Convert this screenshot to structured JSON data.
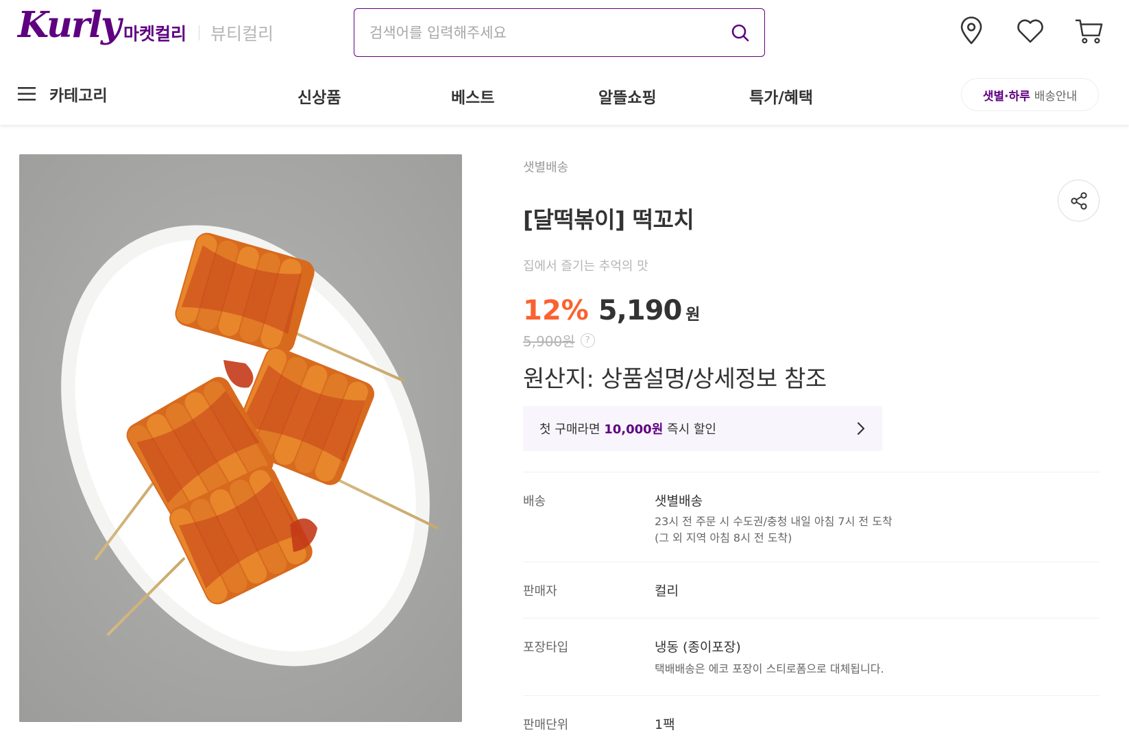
{
  "header": {
    "logo": "Kurly",
    "mall_tabs": [
      {
        "label": "마켓컬리",
        "active": true
      },
      {
        "label": "뷰티컬리",
        "active": false
      }
    ],
    "search": {
      "placeholder": "검색어를 입력해주세요",
      "value": ""
    },
    "icons": [
      "location-pin-icon",
      "heart-icon",
      "cart-icon"
    ]
  },
  "gnb": {
    "category_label": "카테고리",
    "menu": [
      "신상품",
      "베스트",
      "알뜰쇼핑",
      "특가/혜택"
    ],
    "delivery_highlight": "샛별·하루",
    "delivery_text": "배송안내"
  },
  "product": {
    "delivery_type": "샛별배송",
    "title": "[달떡볶이] 떡꼬치",
    "subtitle": "집에서 즐기는 추억의 맛",
    "discount": "12%",
    "price": "5,190",
    "currency": "원",
    "original_price": "5,900원",
    "origin": "원산지: 상품설명/상세정보 참조",
    "coupon": {
      "prefix": "첫 구매라면 ",
      "highlight": "10,000원",
      "suffix": " 즉시 할인"
    },
    "specs": [
      {
        "label": "배송",
        "value": "샛별배송",
        "notes": [
          "23시 전 주문 시 수도권/충청 내일 아침 7시 전 도착",
          "(그 외 지역 아침 8시 전 도착)"
        ]
      },
      {
        "label": "판매자",
        "value": "컬리",
        "notes": []
      },
      {
        "label": "포장타입",
        "value": "냉동 (종이포장)",
        "notes": [
          "택배배송은 에코 포장이 스티로폼으로 대체됩니다."
        ]
      },
      {
        "label": "판매단위",
        "value": "1팩",
        "notes": []
      }
    ]
  },
  "colors": {
    "brand": "#5f0080",
    "discount": "#fa622f",
    "text": "#333333",
    "muted": "#999999"
  }
}
